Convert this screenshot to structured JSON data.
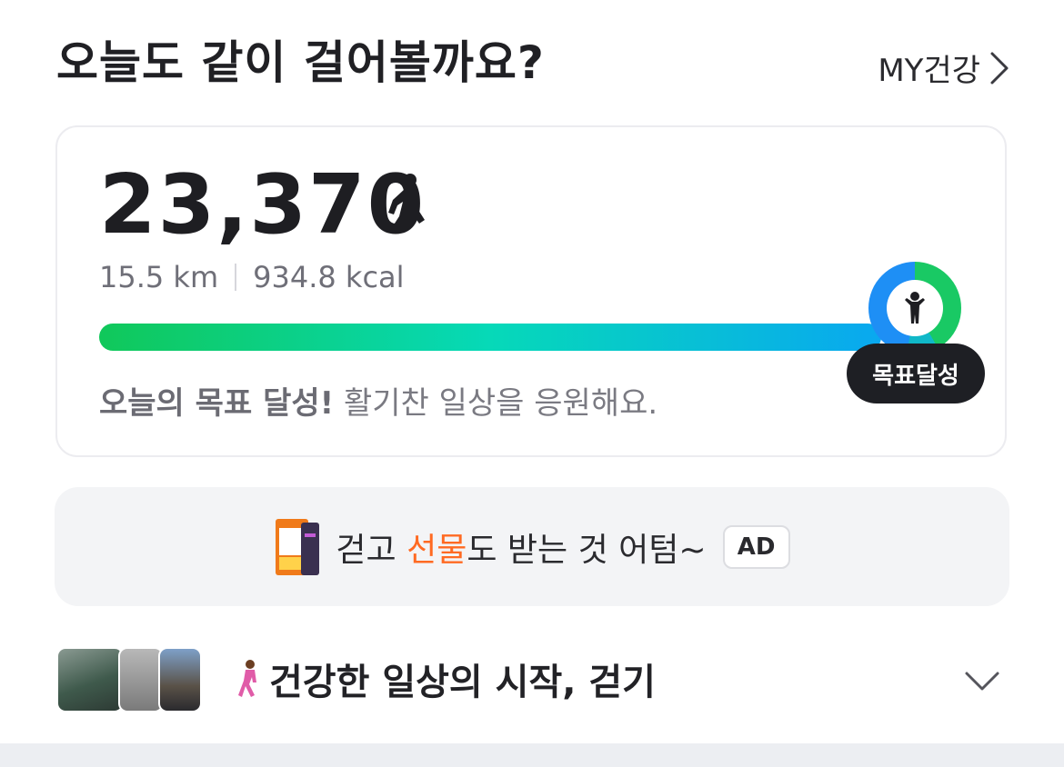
{
  "header": {
    "title": "오늘도 같이 걸어볼까요?",
    "my_link": "MY건강"
  },
  "steps_card": {
    "steps": "23,370",
    "distance": "15.5 km",
    "calories": "934.8 kcal",
    "progress_fraction": 1.0,
    "goal_badge": "목표달성",
    "message_bold": "오늘의 목표 달성!",
    "message_rest": " 활기찬 일상을 응원해요."
  },
  "ad": {
    "text_before": "걷고 ",
    "text_highlight": "선물",
    "text_after": "도 받는 것 어텀~",
    "tag": "AD"
  },
  "content_row": {
    "title": "건강한 일상의 시작, 걷기"
  },
  "icons": [
    "chevron-right-icon",
    "walking-person-icon",
    "goal-person-icon",
    "product-box-icon",
    "woman-walking-icon",
    "chevron-down-icon"
  ],
  "colors": {
    "progress_start": "#10c85a",
    "progress_mid": "#06d9b8",
    "progress_end": "#09a8f0",
    "ad_highlight": "#ff6a22",
    "badge_bg": "#1e1f24"
  }
}
